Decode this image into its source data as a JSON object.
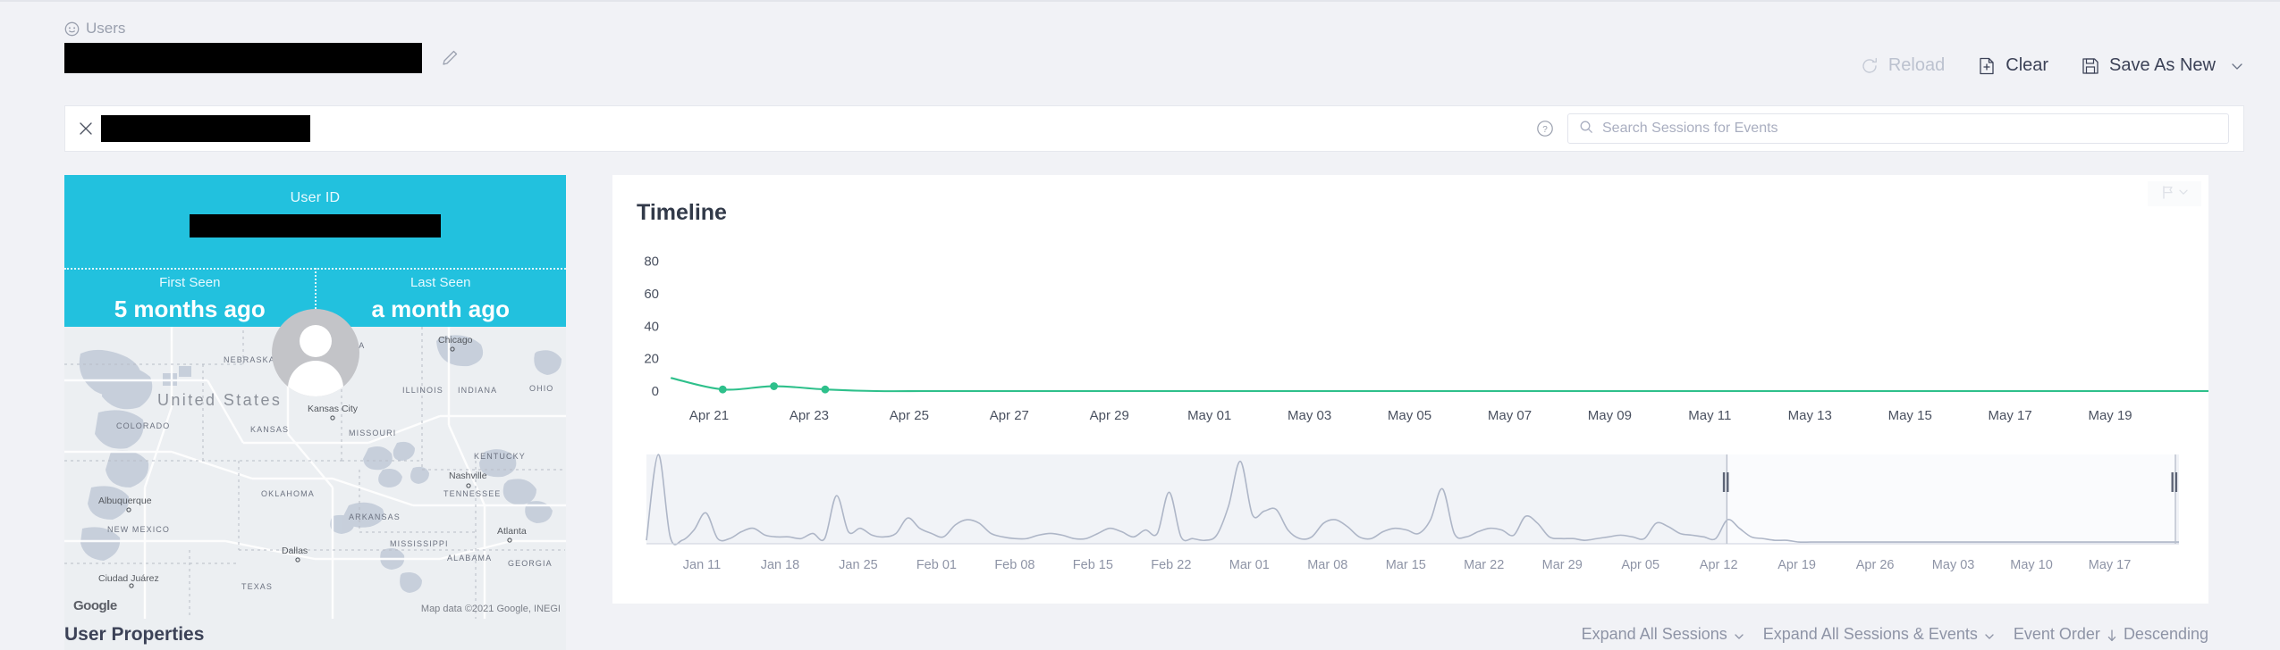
{
  "breadcrumb": {
    "label": "Users",
    "icon": "user-circle-icon"
  },
  "header": {
    "title_redacted": true,
    "edit_icon": "pencil-icon"
  },
  "actions": [
    {
      "label": "Reload",
      "icon": "reload-icon",
      "disabled": true
    },
    {
      "label": "Clear",
      "icon": "file-plus-icon",
      "disabled": false
    },
    {
      "label": "Save As New",
      "icon": "save-icon",
      "disabled": false,
      "has_chevron": true
    }
  ],
  "searchbar": {
    "close_icon": "close-icon",
    "chip_redacted": true,
    "help_icon": "question-circle-icon",
    "search_icon": "search-icon",
    "placeholder": "Search Sessions for Events",
    "value": ""
  },
  "user_card": {
    "user_id_label": "User ID",
    "user_id_redacted": true,
    "first_seen_label": "First Seen",
    "first_seen_value": "5 months ago",
    "last_seen_label": "Last Seen",
    "last_seen_value": "a month ago",
    "avatar_icon": "avatar-placeholder-icon",
    "accent_color": "#22c1de"
  },
  "map": {
    "provider_logo": "Google",
    "attribution": "Map data ©2021 Google, INEGI",
    "country_label": "United States",
    "states": [
      "NEBRASKA",
      "COLORADO",
      "KANSAS",
      "MISSOURI",
      "ILLINOIS",
      "INDIANA",
      "OHIO",
      "KENTUCKY",
      "TENNESSEE",
      "OKLAHOMA",
      "ARKANSAS",
      "NEW MEXICO",
      "MISSISSIPPI",
      "ALABAMA",
      "GEORGIA",
      "TEXAS",
      "WA"
    ],
    "cities": [
      "Chicago",
      "Kansas City",
      "Nashville",
      "Albuquerque",
      "Atlanta",
      "Dallas",
      "Ciudad Juárez"
    ]
  },
  "user_properties": {
    "title": "User Properties"
  },
  "timeline": {
    "title": "Timeline",
    "flag_icon": "flag-icon",
    "flag_chevron": "chevron-down-icon"
  },
  "bottom_controls": {
    "expand_sessions": "Expand All Sessions",
    "expand_sessions_events": "Expand All Sessions & Events",
    "event_order_label": "Event Order",
    "event_order_value": "Descending",
    "sort_icon": "arrow-down-icon"
  },
  "chart_data": [
    {
      "type": "line",
      "name": "timeline-main",
      "title": "Timeline",
      "xlabel": "",
      "ylabel": "",
      "ylim": [
        0,
        88
      ],
      "yticks": [
        0,
        20,
        40,
        60,
        80
      ],
      "grid": false,
      "line_color": "#2ec08b",
      "point_color": "#2ec08b",
      "categories": [
        "Apr 21",
        "Apr 23",
        "Apr 25",
        "Apr 27",
        "Apr 29",
        "May 01",
        "May 03",
        "May 05",
        "May 07",
        "May 09",
        "May 11",
        "May 13",
        "May 15",
        "May 17",
        "May 19"
      ],
      "x": [
        "Apr 20",
        "Apr 21",
        "Apr 22",
        "Apr 23",
        "Apr 24",
        "Apr 25",
        "Apr 26",
        "Apr 27",
        "Apr 28",
        "Apr 29",
        "Apr 30",
        "May 01",
        "May 02",
        "May 03",
        "May 04",
        "May 05",
        "May 06",
        "May 07",
        "May 08",
        "May 09",
        "May 10",
        "May 11",
        "May 12",
        "May 13",
        "May 14",
        "May 15",
        "May 16",
        "May 17",
        "May 18",
        "May 19",
        "May 20"
      ],
      "values": [
        8,
        1,
        3,
        1,
        0,
        0,
        0,
        0,
        0,
        0,
        0,
        0,
        0,
        0,
        0,
        0,
        0,
        0,
        0,
        0,
        0,
        0,
        0,
        0,
        0,
        0,
        0,
        0,
        0,
        0,
        0
      ],
      "markers": [
        {
          "x": "Apr 21",
          "y": 1
        },
        {
          "x": "Apr 22",
          "y": 3
        },
        {
          "x": "Apr 23",
          "y": 1
        }
      ]
    },
    {
      "type": "area",
      "name": "timeline-brush",
      "title": "",
      "xlabel": "",
      "ylabel": "",
      "grid": false,
      "line_color": "#aeb6c7",
      "plot_bg": "#f1f3f7",
      "selection_bg": "#fafbfd",
      "selection": {
        "start": "Apr 19",
        "end": "May 20"
      },
      "categories": [
        "Jan 11",
        "Jan 18",
        "Jan 25",
        "Feb 01",
        "Feb 08",
        "Feb 15",
        "Feb 22",
        "Mar 01",
        "Mar 08",
        "Mar 15",
        "Mar 22",
        "Mar 29",
        "Apr 05",
        "Apr 12",
        "Apr 19",
        "Apr 26",
        "May 03",
        "May 10",
        "May 17"
      ],
      "values": [
        2,
        52,
        4,
        2,
        8,
        18,
        3,
        3,
        7,
        9,
        5,
        4,
        4,
        3,
        6,
        3,
        28,
        7,
        9,
        5,
        4,
        6,
        15,
        9,
        6,
        4,
        11,
        14,
        12,
        6,
        4,
        3,
        3,
        5,
        6,
        5,
        3,
        3,
        6,
        9,
        7,
        4,
        8,
        6,
        30,
        4,
        3,
        2,
        5,
        22,
        48,
        17,
        19,
        20,
        8,
        3,
        4,
        12,
        14,
        10,
        4,
        3,
        7,
        9,
        8,
        6,
        14,
        32,
        6,
        4,
        7,
        9,
        8,
        5,
        16,
        12,
        4,
        3,
        3,
        2,
        3,
        4,
        5,
        4,
        3,
        12,
        10,
        6,
        5,
        4,
        3,
        14,
        9,
        4,
        3,
        2,
        2,
        1,
        1,
        1,
        1,
        1,
        1,
        1,
        1,
        1,
        1,
        1,
        1,
        1,
        1,
        1,
        1,
        1,
        1,
        1,
        1,
        1,
        1,
        1,
        1,
        1,
        1,
        1,
        1,
        1,
        1,
        1,
        1,
        1
      ]
    }
  ]
}
